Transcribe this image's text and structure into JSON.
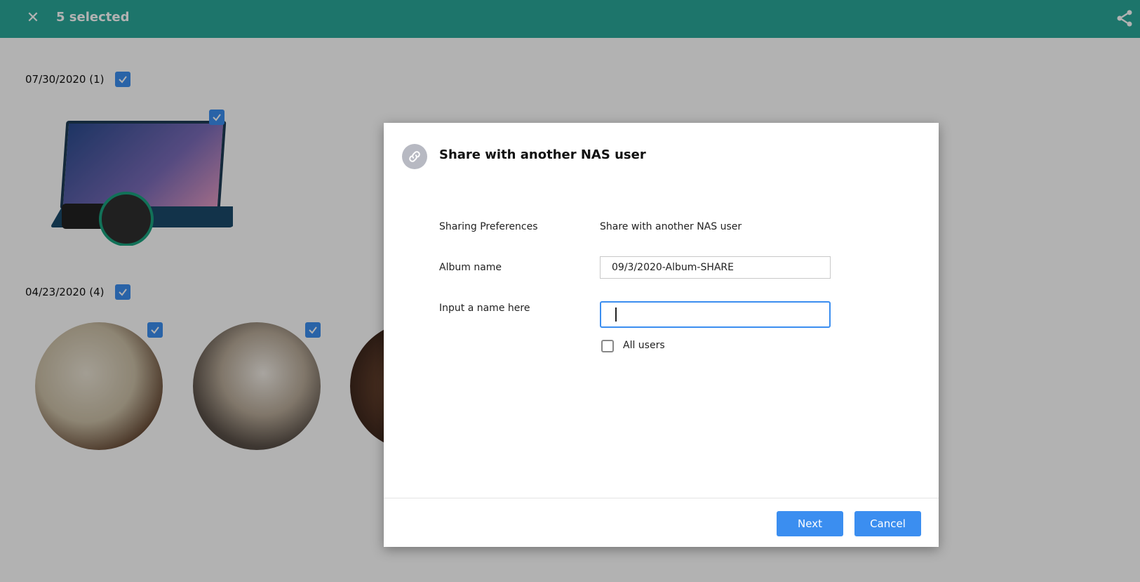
{
  "header": {
    "close_icon": "close-icon",
    "selected_count": "5 selected",
    "share_icon": "share-icon",
    "color": "#2aa89a"
  },
  "groups": [
    {
      "date_label": "07/30/2020 (1)",
      "checked": true
    },
    {
      "date_label": "04/23/2020 (4)",
      "checked": true
    }
  ],
  "dialog": {
    "icon": "link-icon",
    "title": "Share with another NAS user",
    "fields": {
      "sharing_preferences_label": "Sharing Preferences",
      "sharing_preferences_value": "Share with another NAS user",
      "album_name_label": "Album name",
      "album_name_value": "09/3/2020-Album-SHARE",
      "input_name_label": "Input a name here",
      "input_name_value": ""
    },
    "all_users_label": "All users",
    "buttons": {
      "next": "Next",
      "cancel": "Cancel"
    },
    "accent": "#3b8ef0"
  }
}
